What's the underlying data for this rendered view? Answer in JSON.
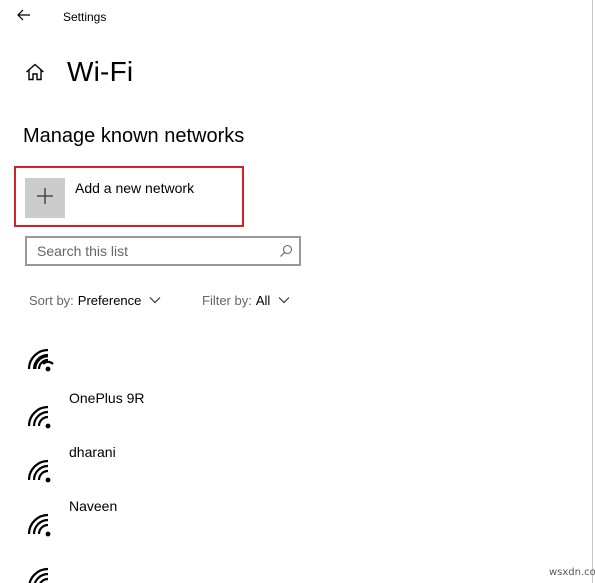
{
  "window": {
    "app_title": "Settings"
  },
  "page": {
    "title": "Wi-Fi",
    "section_title": "Manage known networks"
  },
  "add_network": {
    "label": "Add a new network",
    "icon": "plus-icon"
  },
  "search": {
    "placeholder": "Search this list",
    "value": "",
    "icon": "search-icon"
  },
  "sort": {
    "label": "Sort by:",
    "value": "Preference"
  },
  "filter": {
    "label": "Filter by:",
    "value": "All"
  },
  "networks": [
    {
      "name": ""
    },
    {
      "name": "OnePlus 9R"
    },
    {
      "name": "dharani"
    },
    {
      "name": "Naveen"
    },
    {
      "name": ""
    }
  ],
  "watermark": "wsxdn.com",
  "colors": {
    "highlight": "#d32129",
    "add_tile": "#cccccc",
    "search_border": "#999999",
    "secondary_text": "#666666"
  }
}
